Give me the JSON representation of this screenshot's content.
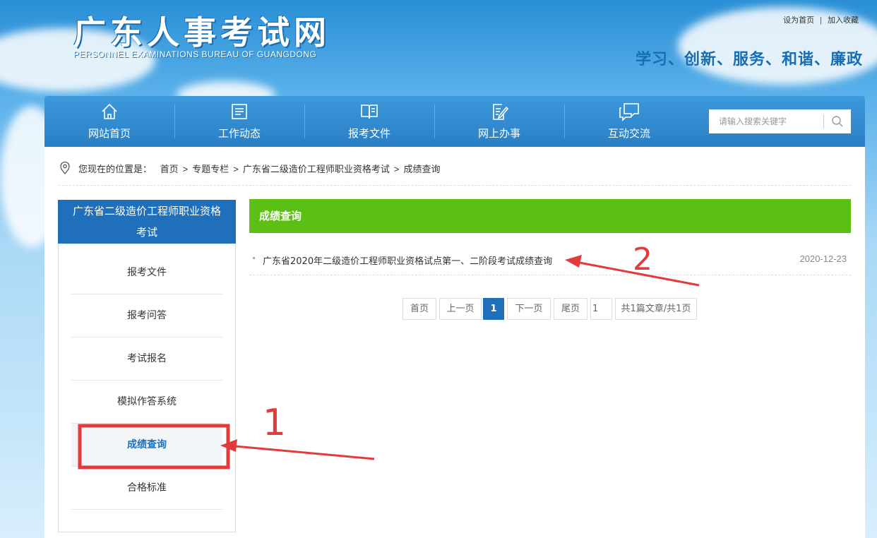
{
  "header": {
    "logo_cn": "广东人事考试网",
    "logo_en": "PERSONNEL EXAMINATIONS BUREAU OF GUANGDONG",
    "top_links": [
      "设为首页",
      "加入收藏"
    ],
    "slogan": "学习、创新、服务、和谐、廉政"
  },
  "nav": {
    "items": [
      {
        "label": "网站首页",
        "icon": "home-icon"
      },
      {
        "label": "工作动态",
        "icon": "news-icon"
      },
      {
        "label": "报考文件",
        "icon": "book-icon"
      },
      {
        "label": "网上办事",
        "icon": "edit-doc-icon"
      },
      {
        "label": "互动交流",
        "icon": "chat-icon"
      }
    ],
    "search_placeholder": "请输入搜索关键字"
  },
  "breadcrumb": {
    "prefix": "您现在的位置是：",
    "items": [
      "首页",
      "专题专栏",
      "广东省二级造价工程师职业资格考试",
      "成绩查询"
    ]
  },
  "sidebar": {
    "title": "广东省二级造价工程师职业资格考试",
    "items": [
      "报考文件",
      "报考问答",
      "考试报名",
      "模拟作答系统",
      "成绩查询",
      "合格标准"
    ],
    "active_index": 4
  },
  "main": {
    "heading": "成绩查询",
    "articles": [
      {
        "title": "广东省2020年二级造价工程师职业资格试点第一、二阶段考试成绩查询",
        "date": "2020-12-23"
      }
    ]
  },
  "pagination": {
    "first": "首页",
    "prev": "上一页",
    "current": "1",
    "next": "下一页",
    "last": "尾页",
    "jump_value": "1",
    "summary": "共1篇文章/共1页"
  },
  "annotations": {
    "mark_1": "1",
    "mark_2": "2",
    "color": "#e23b3b"
  },
  "colors": {
    "nav_blue": "#2a7fc4",
    "sidebar_blue": "#1f6fba",
    "green_header": "#5cbf13"
  }
}
